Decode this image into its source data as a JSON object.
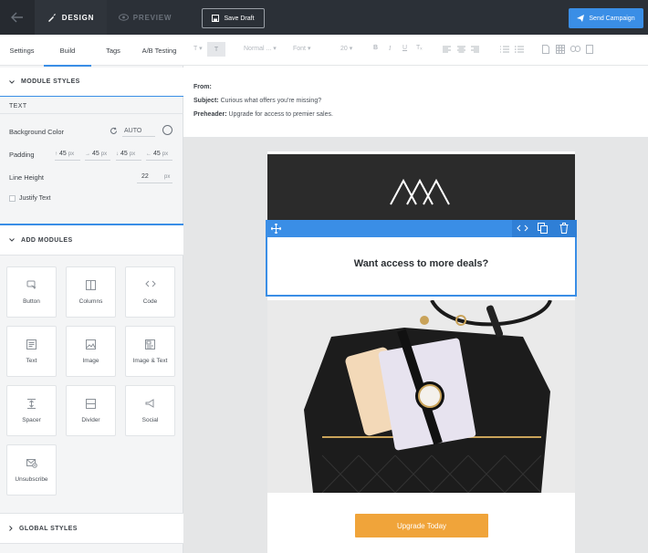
{
  "topbar": {
    "design_label": "DESIGN",
    "preview_label": "PREVIEW",
    "save_draft_label": "Save Draft",
    "send_label": "Send Campaign"
  },
  "sidebar": {
    "tabs": [
      "Settings",
      "Build",
      "Tags",
      "A/B Testing"
    ],
    "active_tab": "Build",
    "module_styles_heading": "MODULE STYLES",
    "text_section": "TEXT",
    "background_color_label": "Background Color",
    "background_color_value": "AUTO",
    "padding_label": "Padding",
    "padding": {
      "top": "45",
      "right": "45",
      "bottom": "45",
      "left": "45",
      "unit": "px"
    },
    "line_height_label": "Line Height",
    "line_height_value": "22",
    "line_height_unit": "px",
    "justify_text_label": "Justify Text",
    "add_modules_heading": "ADD MODULES",
    "modules": [
      {
        "label": "Button",
        "icon": "button-icon"
      },
      {
        "label": "Columns",
        "icon": "columns-icon"
      },
      {
        "label": "Code",
        "icon": "code-icon"
      },
      {
        "label": "Text",
        "icon": "text-icon"
      },
      {
        "label": "Image",
        "icon": "image-icon"
      },
      {
        "label": "Image & Text",
        "icon": "image-text-icon"
      },
      {
        "label": "Spacer",
        "icon": "spacer-icon"
      },
      {
        "label": "Divider",
        "icon": "divider-icon"
      },
      {
        "label": "Social",
        "icon": "social-icon"
      },
      {
        "label": "Unsubscribe",
        "icon": "unsubscribe-icon"
      }
    ],
    "global_styles_heading": "GLOBAL STYLES"
  },
  "format_toolbar": {
    "paragraph_style": "Normal ...",
    "font": "Font",
    "font_size": "20",
    "bold": "B",
    "italic": "I",
    "underline": "U",
    "clear_format": "Tₓ"
  },
  "email_meta": {
    "from_label": "From:",
    "from_value": "",
    "subject_label": "Subject:",
    "subject_value": "Curious what offers you're missing?",
    "preheader_label": "Preheader:",
    "preheader_value": "Upgrade for access to premier sales."
  },
  "email_body": {
    "headline": "Want access to more deals?",
    "cta_label": "Upgrade Today"
  },
  "colors": {
    "accent": "#3a8ee6",
    "topbar": "#2b3037",
    "cta": "#f0a43a",
    "logo_bg": "#2b2b2b"
  }
}
